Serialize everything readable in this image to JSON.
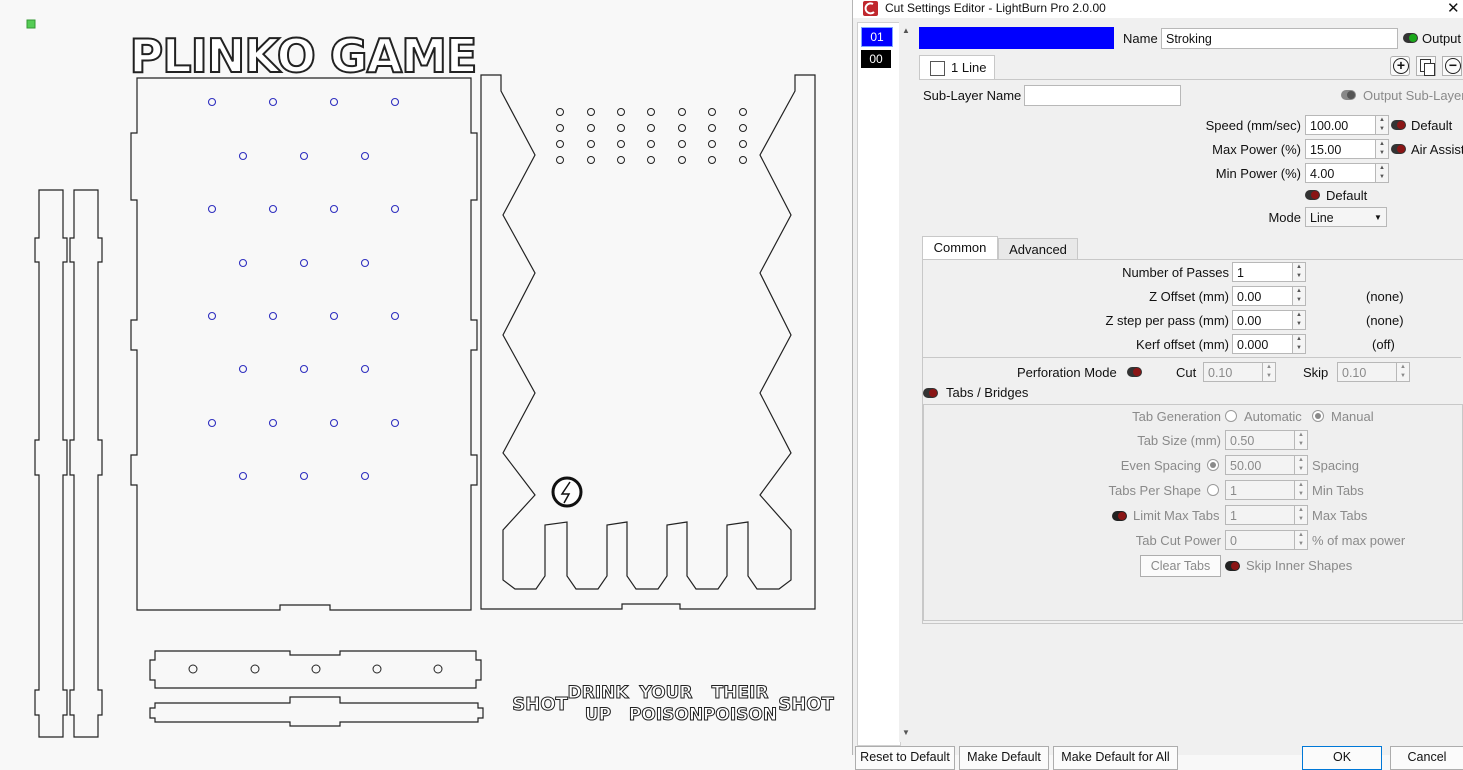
{
  "canvas": {
    "title_text": "PLINKO GAME",
    "drink_labels": [
      "SHOT",
      "DRINK",
      "UP",
      "YOUR",
      "POISON",
      "THEIR",
      "POISON",
      "SHOT"
    ]
  },
  "dialog": {
    "title": "Cut Settings Editor - LightBurn Pro 2.0.00",
    "close_label": "✕",
    "layers": [
      "01",
      "00"
    ],
    "layer_color": "#0000ff",
    "name_label": "Name",
    "name_value": "Stroking",
    "output_label": "Output",
    "sublayer_tab_label": "1 Line",
    "sublayer_name_label": "Sub-Layer Name",
    "sublayer_name_value": "",
    "output_sublayer_label": "Output Sub-Layer",
    "speed_label": "Speed (mm/sec)",
    "speed_value": "100.00",
    "default_label": "Default",
    "max_power_label": "Max Power (%)",
    "max_power_value": "15.00",
    "air_assist_label": "Air Assist",
    "min_power_label": "Min Power (%)",
    "min_power_value": "4.00",
    "default2_label": "Default",
    "mode_label": "Mode",
    "mode_value": "Line",
    "tabs": [
      "Common",
      "Advanced"
    ],
    "passes_label": "Number of Passes",
    "passes_value": "1",
    "z_offset_label": "Z Offset (mm)",
    "z_offset_value": "0.00",
    "z_offset_note": "(none)",
    "z_step_label": "Z step per pass (mm)",
    "z_step_value": "0.00",
    "z_step_note": "(none)",
    "kerf_label": "Kerf offset (mm)",
    "kerf_value": "0.000",
    "kerf_note": "(off)",
    "perforation_label": "Perforation Mode",
    "cut_label": "Cut",
    "cut_value": "0.10",
    "skip_label": "Skip",
    "skip_value": "0.10",
    "tabs_bridges_label": "Tabs / Bridges",
    "tab_generation_label": "Tab Generation",
    "automatic_label": "Automatic",
    "manual_label": "Manual",
    "tab_size_label": "Tab Size (mm)",
    "tab_size_value": "0.50",
    "even_spacing_label": "Even Spacing",
    "even_spacing_value": "50.00",
    "spacing_label": "Spacing",
    "tabs_per_shape_label": "Tabs Per Shape",
    "tabs_per_shape_value": "1",
    "min_tabs_label": "Min Tabs",
    "limit_max_tabs_label": "Limit Max Tabs",
    "limit_max_tabs_value": "1",
    "max_tabs_label": "Max Tabs",
    "tab_cut_power_label": "Tab Cut Power",
    "tab_cut_power_value": "0",
    "percent_max_power_label": "% of max power",
    "clear_tabs_label": "Clear Tabs",
    "skip_inner_label": "Skip Inner Shapes",
    "bottom_buttons": [
      "Reset to Default",
      "Make Default",
      "Make Default for All",
      "OK",
      "Cancel"
    ]
  }
}
